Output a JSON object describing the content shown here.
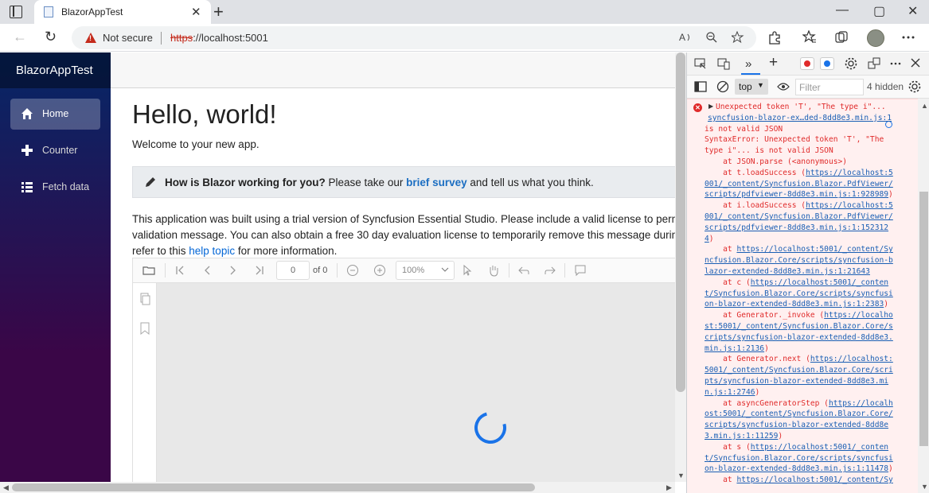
{
  "browser": {
    "tab_title": "BlazorAppTest",
    "tab_close": "✕",
    "new_tab": "+",
    "window_controls": {
      "minimize": "—",
      "maximize": "▢",
      "close": "✕"
    },
    "nav": {
      "back": "←",
      "reload": "↻"
    },
    "address": {
      "security_label": "Not secure",
      "url_scheme": "https",
      "url_rest": "://localhost:5001"
    },
    "toolbar_icons": [
      "read-aloud-icon",
      "zoom-icon",
      "favorites-add-icon",
      "extensions-icon",
      "favorites-icon",
      "collections-icon",
      "profile-avatar",
      "more-icon"
    ]
  },
  "app": {
    "brand": "BlazorAppTest",
    "nav_items": [
      {
        "label": "Home",
        "icon": "home-icon",
        "active": true
      },
      {
        "label": "Counter",
        "icon": "plus-icon",
        "active": false
      },
      {
        "label": "Fetch data",
        "icon": "list-icon",
        "active": false
      }
    ],
    "heading": "Hello, world!",
    "welcome": "Welcome to your new app.",
    "survey": {
      "bold": "How is Blazor working for you?",
      "text_before": " Please take our ",
      "link": "brief survey",
      "text_after": " and tell us what you think."
    },
    "trial": {
      "line1": "This application was built using a trial version of Syncfusion Essential Studio. Please include a valid license to permar",
      "line2": "validation message. You can also obtain a free 30 day evaluation license to temporarily remove this message during t",
      "line3_before": "refer to this ",
      "line3_link": "help topic",
      "line3_after": " for more information."
    },
    "pdf_viewer": {
      "page_number": "0",
      "page_total": "of 0",
      "zoom": "100%",
      "loading": true
    }
  },
  "devtools": {
    "context": "top",
    "filter_placeholder": "Filter",
    "hidden": "4 hidden",
    "console_lines": [
      {
        "text": "Unexpected token 'T', \"The type i\"...",
        "kind": "error"
      },
      {
        "text": "syncfusion-blazor-ex…ded-8dd8e3.min.js:1",
        "kind": "link"
      },
      {
        "text": "is not valid JSON",
        "kind": "error"
      },
      {
        "text": "SyntaxError: Unexpected token 'T', \"The",
        "kind": "error"
      },
      {
        "text": "type i\"... is not valid JSON",
        "kind": "error"
      },
      {
        "text": "    at JSON.parse (<anonymous>)",
        "kind": "error"
      },
      {
        "text": "    at t.loadSuccess (",
        "link": "https://localhost:5",
        "after": "",
        "kind": "mixed"
      },
      {
        "text": "",
        "link": "001/_content/Syncfusion.Blazor.PdfViewer/",
        "after": "",
        "kind": "mixed"
      },
      {
        "text": "",
        "link": "scripts/pdfviewer-8dd8e3.min.js:1:928989",
        "after": ")",
        "kind": "mixed"
      },
      {
        "text": "    at i.loadSuccess (",
        "link": "https://localhost:5",
        "after": "",
        "kind": "mixed"
      },
      {
        "text": "",
        "link": "001/_content/Syncfusion.Blazor.PdfViewer/",
        "after": "",
        "kind": "mixed"
      },
      {
        "text": "",
        "link": "scripts/pdfviewer-8dd8e3.min.js:1:152312",
        "after": "",
        "kind": "mixed"
      },
      {
        "text": "",
        "link": "4",
        "after": ")",
        "kind": "mixed"
      },
      {
        "text": "    at ",
        "link": "https://localhost:5001/_content/Sy",
        "after": "",
        "kind": "mixed"
      },
      {
        "text": "",
        "link": "ncfusion.Blazor.Core/scripts/syncfusion-b",
        "after": "",
        "kind": "mixed"
      },
      {
        "text": "",
        "link": "lazor-extended-8dd8e3.min.js:1:21643",
        "after": "",
        "kind": "mixed"
      },
      {
        "text": "    at c (",
        "link": "https://localhost:5001/_conten",
        "after": "",
        "kind": "mixed"
      },
      {
        "text": "",
        "link": "t/Syncfusion.Blazor.Core/scripts/syncfusi",
        "after": "",
        "kind": "mixed"
      },
      {
        "text": "",
        "link": "on-blazor-extended-8dd8e3.min.js:1:2383",
        "after": ")",
        "kind": "mixed"
      },
      {
        "text": "    at Generator._invoke (",
        "link": "https://localho",
        "after": "",
        "kind": "mixed"
      },
      {
        "text": "",
        "link": "st:5001/_content/Syncfusion.Blazor.Core/s",
        "after": "",
        "kind": "mixed"
      },
      {
        "text": "",
        "link": "cripts/syncfusion-blazor-extended-8dd8e3.",
        "after": "",
        "kind": "mixed"
      },
      {
        "text": "",
        "link": "min.js:1:2136",
        "after": ")",
        "kind": "mixed"
      },
      {
        "text": "    at Generator.next (",
        "link": "https://localhost:",
        "after": "",
        "kind": "mixed"
      },
      {
        "text": "",
        "link": "5001/_content/Syncfusion.Blazor.Core/scri",
        "after": "",
        "kind": "mixed"
      },
      {
        "text": "",
        "link": "pts/syncfusion-blazor-extended-8dd8e3.mi",
        "after": "",
        "kind": "mixed"
      },
      {
        "text": "",
        "link": "n.js:1:2746",
        "after": ")",
        "kind": "mixed"
      },
      {
        "text": "    at asyncGeneratorStep (",
        "link": "https://localh",
        "after": "",
        "kind": "mixed"
      },
      {
        "text": "",
        "link": "ost:5001/_content/Syncfusion.Blazor.Core/",
        "after": "",
        "kind": "mixed"
      },
      {
        "text": "",
        "link": "scripts/syncfusion-blazor-extended-8dd8e",
        "after": "",
        "kind": "mixed"
      },
      {
        "text": "",
        "link": "3.min.js:1:11259",
        "after": ")",
        "kind": "mixed"
      },
      {
        "text": "    at s (",
        "link": "https://localhost:5001/_conten",
        "after": "",
        "kind": "mixed"
      },
      {
        "text": "",
        "link": "t/Syncfusion.Blazor.Core/scripts/syncfusi",
        "after": "",
        "kind": "mixed"
      },
      {
        "text": "",
        "link": "on-blazor-extended-8dd8e3.min.js:1:11478",
        "after": ")",
        "kind": "mixed"
      },
      {
        "text": "    at ",
        "link": "https://localhost:5001/_content/Sy",
        "after": "",
        "kind": "mixed"
      }
    ]
  }
}
